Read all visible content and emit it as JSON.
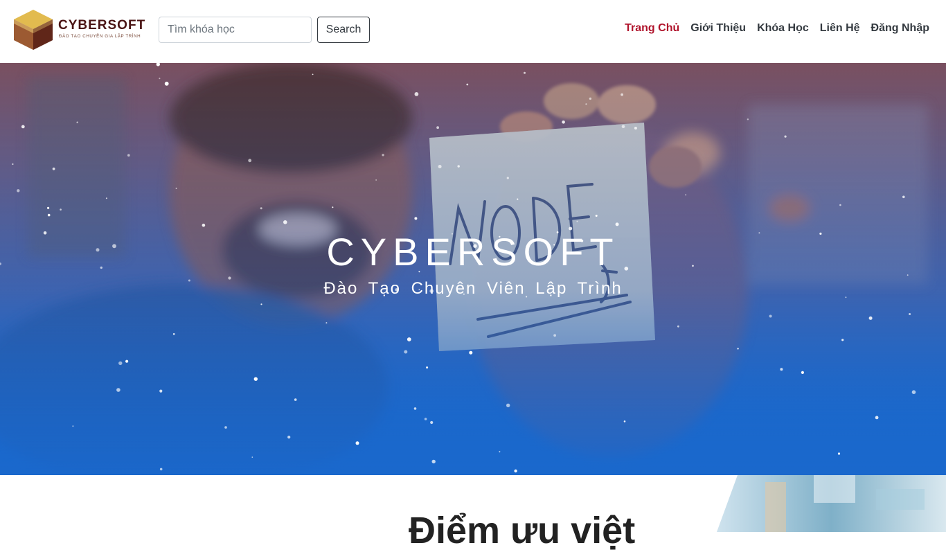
{
  "brand": {
    "name": "CYBERSOFT",
    "tagline": "ĐÀO TẠO CHUYÊN GIA LẬP TRÌNH"
  },
  "search": {
    "placeholder": "Tìm khóa học",
    "value": "",
    "button_label": "Search"
  },
  "nav": {
    "items": [
      {
        "label": "Trang Chủ",
        "active": true
      },
      {
        "label": "Giới Thiệu",
        "active": false
      },
      {
        "label": "Khóa Học",
        "active": false
      },
      {
        "label": "Liên Hệ",
        "active": false
      },
      {
        "label": "Đăng Nhập",
        "active": false
      }
    ]
  },
  "hero": {
    "title": "CYBERSOFT",
    "subtitle": "Đào Tạo Chuyên Viên Lập Trình",
    "note_text": "NODE"
  },
  "section": {
    "heading": "Điểm ưu việt"
  },
  "colors": {
    "accent": "#b0132b",
    "hero_blue": "#1a68cc",
    "nav_text": "#343a40",
    "brand_dark": "#4a1414",
    "brand_gold": "#d9a93a"
  },
  "icons": {
    "logo": "gold-cube-icon"
  }
}
